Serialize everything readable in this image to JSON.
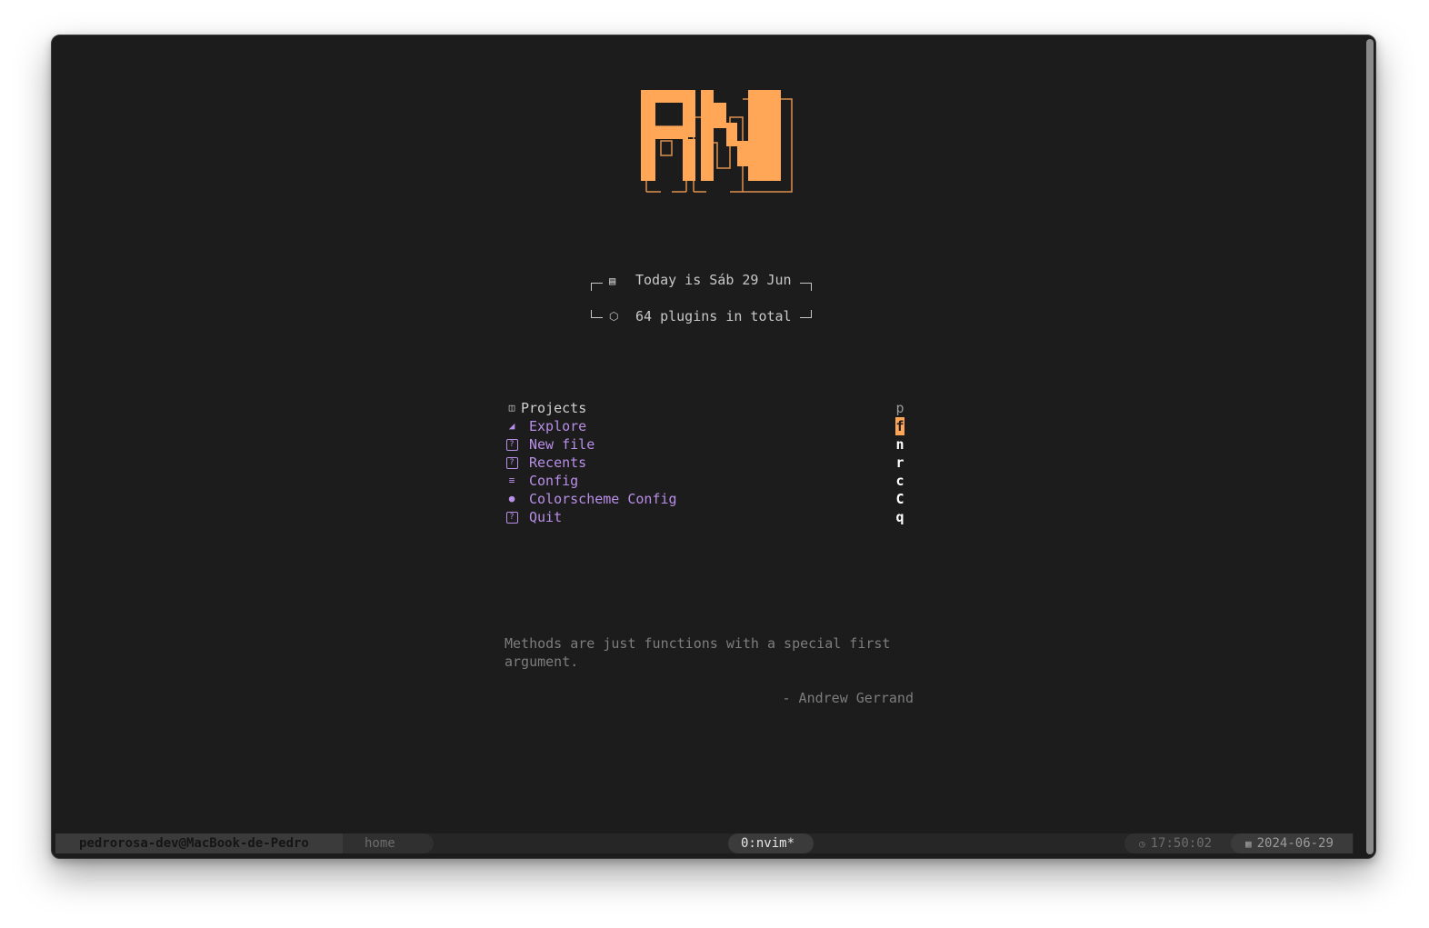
{
  "header": {
    "date_line": "Today is Sáb 29 Jun",
    "plugins_line": "64 plugins in total",
    "calendar_icon": "calendar-icon",
    "package_icon": "package-icon"
  },
  "menu": {
    "title": {
      "label": "Projects",
      "key": "p",
      "icon": "book-icon"
    },
    "items": [
      {
        "label": "Explore",
        "key": "f",
        "icon": "folder-icon",
        "selected": true
      },
      {
        "label": "New file",
        "key": "n",
        "icon": "unknown-glyph-icon"
      },
      {
        "label": "Recents",
        "key": "r",
        "icon": "unknown-glyph-icon"
      },
      {
        "label": "Config",
        "key": "c",
        "icon": "sliders-icon"
      },
      {
        "label": "Colorscheme Config",
        "key": "C",
        "icon": "palette-icon"
      },
      {
        "label": "Quit",
        "key": "q",
        "icon": "unknown-glyph-icon"
      }
    ]
  },
  "quote": {
    "text": "Methods are just functions with a special first argument.",
    "author": "- Andrew Gerrand"
  },
  "statusbar": {
    "host": "pedrorosa-dev@MacBook-de-Pedro",
    "session": "home",
    "window": "0:nvim*",
    "time": "17:50:02",
    "date": "2024-06-29",
    "clock_icon": "clock-icon",
    "date_icon": "calendar-icon"
  },
  "colors": {
    "background": "#1c1c1c",
    "accent_orange": "#ffa657",
    "menu_purple": "#b98ee8",
    "muted_text": "#7d7d7d"
  }
}
